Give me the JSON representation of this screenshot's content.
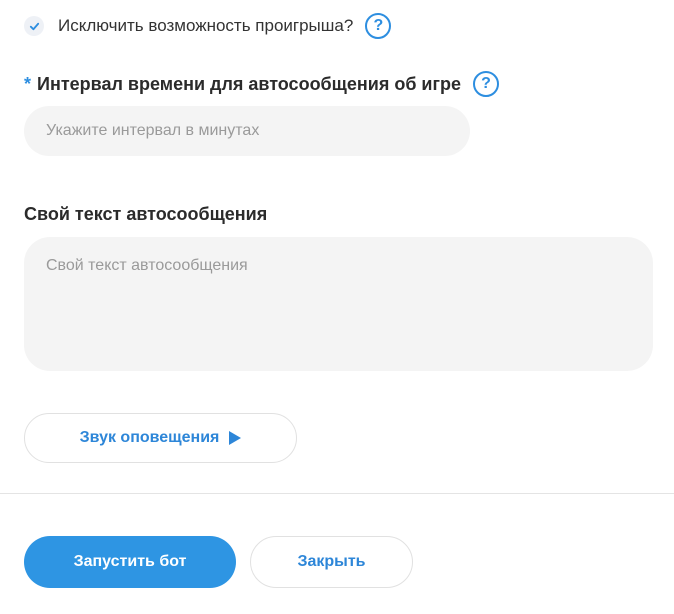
{
  "form": {
    "exclude_loss": {
      "label": "Исключить возможность проигрыша?",
      "checked": true,
      "help_icon": "question-circle-icon",
      "help_glyph": "?"
    },
    "interval": {
      "required_mark": "*",
      "label": "Интервал времени для автосообщения об игре",
      "help_icon": "question-circle-icon",
      "help_glyph": "?",
      "value": "",
      "placeholder": "Укажите интервал в минутах"
    },
    "custom_text": {
      "label": "Свой текст автосообщения",
      "value": "",
      "placeholder": "Свой текст автосообщения"
    },
    "sound": {
      "label": "Звук оповещения",
      "icon": "play-icon"
    }
  },
  "footer": {
    "launch_label": "Запустить бот",
    "close_label": "Закрыть"
  },
  "colors": {
    "accent": "#2e95e3",
    "accent_text": "#2d86d8",
    "field_bg": "#f4f4f4",
    "divider": "#e4e4e4"
  }
}
